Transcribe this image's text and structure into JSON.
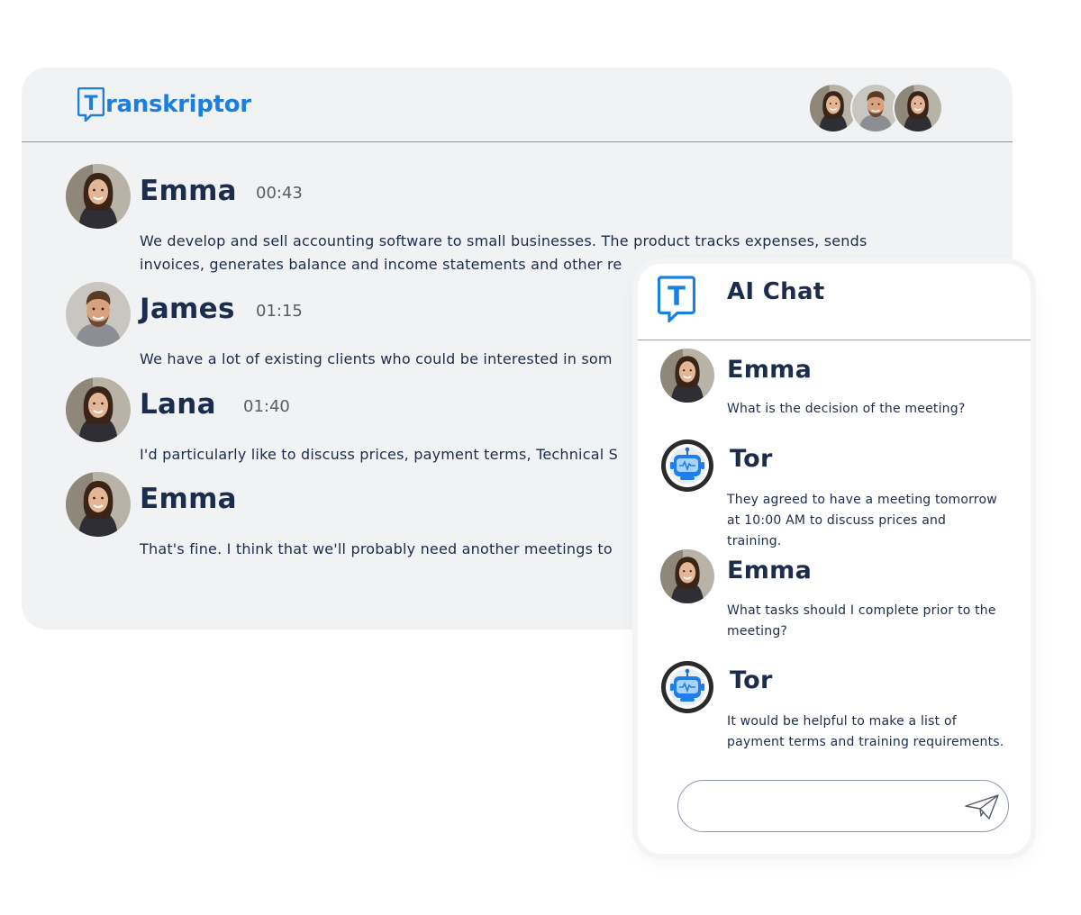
{
  "app": {
    "brand_initial": "T",
    "brand_rest": "ranskriptor"
  },
  "transcript": [
    {
      "speaker": "Emma",
      "time": "00:43",
      "text": "We develop and sell accounting software to small businesses. The product tracks expenses, sends invoices, generates balance and income statements and other re"
    },
    {
      "speaker": "James",
      "time": "01:15",
      "text": "We have a lot of existing clients who could be interested in som"
    },
    {
      "speaker": "Lana",
      "time": "01:40",
      "text": "I'd particularly like to discuss prices, payment terms, Technical S"
    },
    {
      "speaker": "Emma",
      "time": "",
      "text": "That's fine. I think that we'll probably need another meetings to"
    }
  ],
  "chat": {
    "logo_letter": "T",
    "title": "AI Chat",
    "messages": [
      {
        "name": "Emma",
        "text": "What is the decision of the meeting?"
      },
      {
        "name": "Tor",
        "text": "They agreed to have a meeting tomorrow at 10:00 AM to discuss prices and training."
      },
      {
        "name": "Emma",
        "text": "What tasks should I complete prior to the meeting?"
      },
      {
        "name": "Tor",
        "text": "It would be helpful to make a list of payment terms and training requirements."
      }
    ],
    "input_value": ""
  },
  "colors": {
    "brand": "#1a7fe0",
    "text": "#1c2c4c",
    "panel": "#f1f2f4"
  },
  "icons": [
    "transkriptor-logo-icon",
    "ai-chat-logo-icon",
    "bot-avatar-icon",
    "send-icon"
  ]
}
